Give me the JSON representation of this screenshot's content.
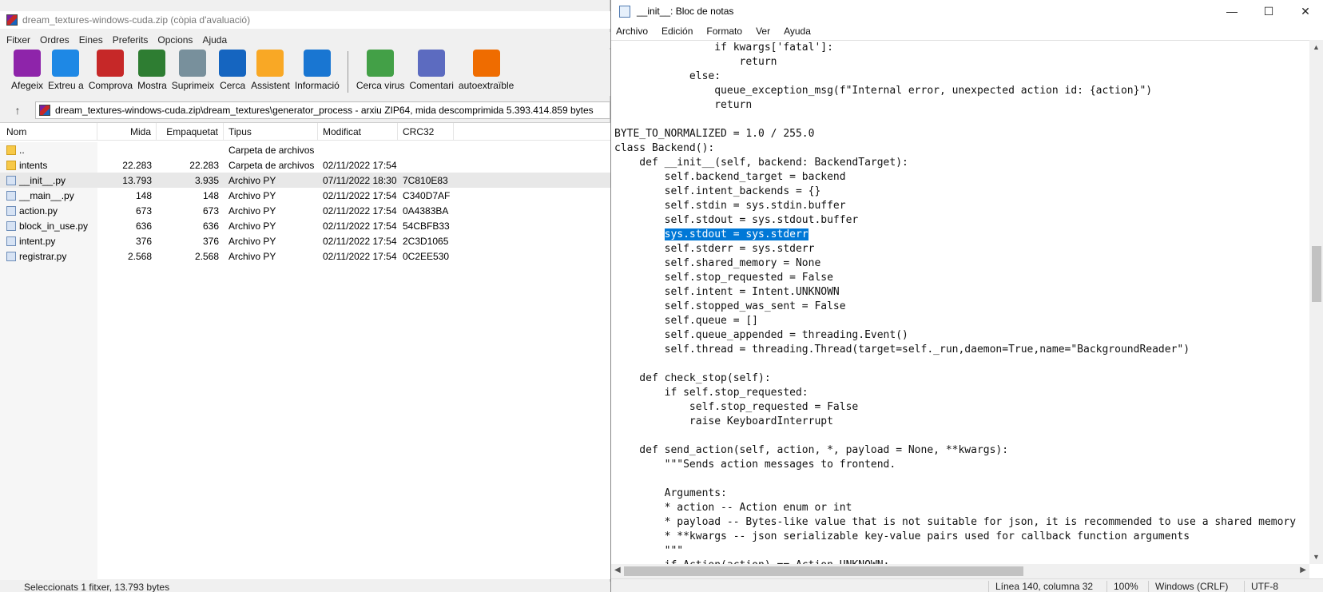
{
  "winrar": {
    "title": "dream_textures-windows-cuda.zip (còpia d'avaluació)",
    "menu": [
      "Fitxer",
      "Ordres",
      "Eines",
      "Preferits",
      "Opcions",
      "Ajuda"
    ],
    "toolbar": [
      {
        "label": "Afegeix",
        "icon": "books-add-icon",
        "color": "#8e24aa"
      },
      {
        "label": "Extreu a",
        "icon": "folder-extract-icon",
        "color": "#1e88e5"
      },
      {
        "label": "Comprova",
        "icon": "checklist-icon",
        "color": "#c62828"
      },
      {
        "label": "Mostra",
        "icon": "book-view-icon",
        "color": "#2e7d32"
      },
      {
        "label": "Suprimeix",
        "icon": "trash-icon",
        "color": "#78909c"
      },
      {
        "label": "Cerca",
        "icon": "magnifier-icon",
        "color": "#1565c0"
      },
      {
        "label": "Assistent",
        "icon": "magic-wand-icon",
        "color": "#f9a825"
      },
      {
        "label": "Informació",
        "icon": "info-icon",
        "color": "#1976d2"
      },
      {
        "label": "Cerca virus",
        "icon": "virus-scan-icon",
        "color": "#43a047"
      },
      {
        "label": "Comentari",
        "icon": "comment-icon",
        "color": "#5c6bc0"
      },
      {
        "label": "autoextraïble",
        "icon": "sfx-box-icon",
        "color": "#ef6c00"
      }
    ],
    "address": "dream_textures-windows-cuda.zip\\dream_textures\\generator_process - arxiu ZIP64, mida descomprimida 5.393.414.859 bytes",
    "columns": [
      "Nom",
      "Mida",
      "Empaquetat",
      "Tipus",
      "Modificat",
      "CRC32"
    ],
    "files": [
      {
        "name": "..",
        "size": "",
        "packed": "",
        "type": "Carpeta de archivos",
        "modified": "",
        "crc": "",
        "kind": "folder"
      },
      {
        "name": "intents",
        "size": "22.283",
        "packed": "22.283",
        "type": "Carpeta de archivos",
        "modified": "02/11/2022 17:54",
        "crc": "",
        "kind": "folder"
      },
      {
        "name": "__init__.py",
        "size": "13.793",
        "packed": "3.935",
        "type": "Archivo PY",
        "modified": "07/11/2022 18:30",
        "crc": "7C810E83",
        "kind": "py",
        "selected": true
      },
      {
        "name": "__main__.py",
        "size": "148",
        "packed": "148",
        "type": "Archivo PY",
        "modified": "02/11/2022 17:54",
        "crc": "C340D7AF",
        "kind": "py"
      },
      {
        "name": "action.py",
        "size": "673",
        "packed": "673",
        "type": "Archivo PY",
        "modified": "02/11/2022 17:54",
        "crc": "0A4383BA",
        "kind": "py"
      },
      {
        "name": "block_in_use.py",
        "size": "636",
        "packed": "636",
        "type": "Archivo PY",
        "modified": "02/11/2022 17:54",
        "crc": "54CBFB33",
        "kind": "py"
      },
      {
        "name": "intent.py",
        "size": "376",
        "packed": "376",
        "type": "Archivo PY",
        "modified": "02/11/2022 17:54",
        "crc": "2C3D1065",
        "kind": "py"
      },
      {
        "name": "registrar.py",
        "size": "2.568",
        "packed": "2.568",
        "type": "Archivo PY",
        "modified": "02/11/2022 17:54",
        "crc": "0C2EE530",
        "kind": "py"
      }
    ],
    "status": "Seleccionats 1 fitxer, 13.793 bytes"
  },
  "notepad": {
    "title": "__init__: Bloc de notas",
    "window_controls": [
      "—",
      "☐",
      "✕"
    ],
    "menu": [
      "Archivo",
      "Edición",
      "Formato",
      "Ver",
      "Ayuda"
    ],
    "code_lines": [
      "                if kwargs['fatal']:",
      "                    return",
      "            else:",
      "                queue_exception_msg(f\"Internal error, unexpected action id: {action}\")",
      "                return",
      "",
      "BYTE_TO_NORMALIZED = 1.0 / 255.0",
      "class Backend():",
      "    def __init__(self, backend: BackendTarget):",
      "        self.backend_target = backend",
      "        self.intent_backends = {}",
      "        self.stdin = sys.stdin.buffer",
      "        self.stdout = sys.stdout.buffer",
      "        sys.stdout = sys.stderr",
      "        self.stderr = sys.stderr",
      "        self.shared_memory = None",
      "        self.stop_requested = False",
      "        self.intent = Intent.UNKNOWN",
      "        self.stopped_was_sent = False",
      "        self.queue = []",
      "        self.queue_appended = threading.Event()",
      "        self.thread = threading.Thread(target=self._run,daemon=True,name=\"BackgroundReader\")",
      "",
      "    def check_stop(self):",
      "        if self.stop_requested:",
      "            self.stop_requested = False",
      "            raise KeyboardInterrupt",
      "",
      "    def send_action(self, action, *, payload = None, **kwargs):",
      "        \"\"\"Sends action messages to frontend.",
      "",
      "        Arguments:",
      "        * action -- Action enum or int",
      "        * payload -- Bytes-like value that is not suitable for json, it is recommended to use a shared memory",
      "        * **kwargs -- json serializable key-value pairs used for callback function arguments",
      "        \"\"\"",
      "        if Action(action) == Action.UNKNOWN:"
    ],
    "highlight": {
      "line": 13,
      "prefix": "        ",
      "text": "sys.stdout = sys.stderr"
    },
    "status": {
      "position": "Línea 140, columna 32",
      "zoom": "100%",
      "line_ending": "Windows (CRLF)",
      "encoding": "UTF-8"
    }
  }
}
